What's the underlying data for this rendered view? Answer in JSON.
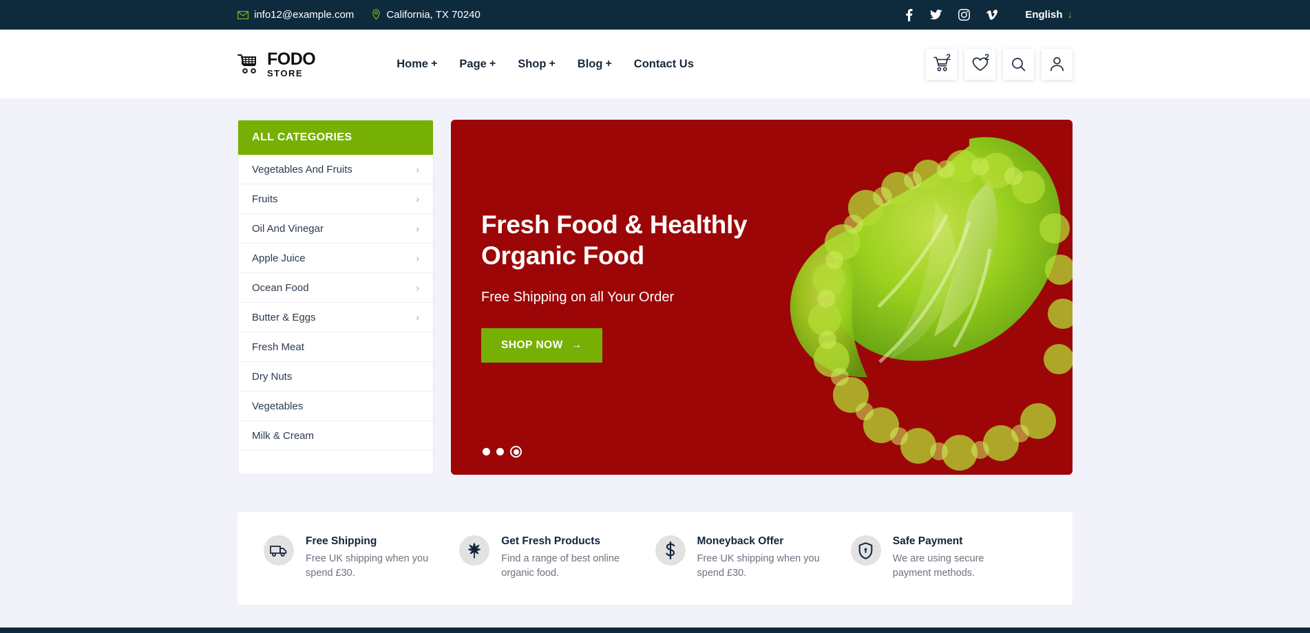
{
  "topbar": {
    "email": "info12@example.com",
    "location": "California, TX 70240",
    "social": [
      {
        "name": "facebook-icon",
        "label": "Facebook"
      },
      {
        "name": "twitter-icon",
        "label": "Twitter"
      },
      {
        "name": "instagram-icon",
        "label": "Instagram"
      },
      {
        "name": "vimeo-icon",
        "label": "Vimeo"
      }
    ],
    "language": "English",
    "language_arrow": "↓"
  },
  "header": {
    "logo_main": "FODO",
    "logo_sub": "STORE",
    "nav": [
      {
        "label": "Home",
        "plus": "+"
      },
      {
        "label": "Page",
        "plus": "+"
      },
      {
        "label": "Shop",
        "plus": "+"
      },
      {
        "label": "Blog",
        "plus": "+"
      },
      {
        "label": "Contact Us",
        "plus": ""
      }
    ],
    "cart_badge": "2",
    "wishlist_badge": "2"
  },
  "categories": {
    "title": "ALL CATEGORIES",
    "items": [
      {
        "label": "Vegetables And Fruits",
        "chevron": "›"
      },
      {
        "label": "Fruits",
        "chevron": "›"
      },
      {
        "label": "Oil And Vinegar",
        "chevron": "›"
      },
      {
        "label": "Apple Juice",
        "chevron": "›"
      },
      {
        "label": "Ocean Food",
        "chevron": "›"
      },
      {
        "label": "Butter & Eggs",
        "chevron": "›"
      },
      {
        "label": "Fresh Meat",
        "chevron": ""
      },
      {
        "label": "Dry Nuts",
        "chevron": ""
      },
      {
        "label": "Vegetables",
        "chevron": ""
      },
      {
        "label": "Milk & Cream",
        "chevron": ""
      }
    ]
  },
  "hero": {
    "title_line1": "Fresh Food & Healthly",
    "title_line2": "Organic Food",
    "subtitle": "Free Shipping on all Your Order",
    "cta": "SHOP NOW",
    "cta_arrow": "→",
    "slides": 3,
    "active_slide": 3,
    "bg_color": "#9c0606",
    "accent_color": "#77b005"
  },
  "features": [
    {
      "icon": "truck-icon",
      "title": "Free Shipping",
      "desc": "Free UK shipping when you spend £30."
    },
    {
      "icon": "leaf-icon",
      "title": "Get Fresh Products",
      "desc": "Find a range of best online organic food."
    },
    {
      "icon": "dollar-icon",
      "title": "Moneyback Offer",
      "desc": "Free UK shipping when you spend £30."
    },
    {
      "icon": "shield-lock-icon",
      "title": "Safe Payment",
      "desc": "We are using secure payment methods."
    }
  ]
}
